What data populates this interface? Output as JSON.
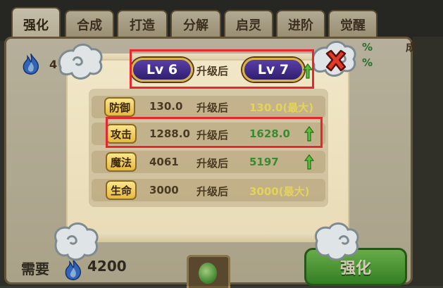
{
  "tabs": [
    {
      "label": "强化"
    },
    {
      "label": "合成"
    },
    {
      "label": "打造"
    },
    {
      "label": "分解"
    },
    {
      "label": "启灵"
    },
    {
      "label": "进阶"
    },
    {
      "label": "觉醒"
    }
  ],
  "background": {
    "cost_prefix_visible": "4",
    "pct_top": "%",
    "pct_bottom": "%",
    "top_right_text": "成"
  },
  "upgrade": {
    "current_level": "Lv 6",
    "after_label": "升级后",
    "next_level": "Lv 7"
  },
  "stats": [
    {
      "name": "防御",
      "old": "130.0",
      "after": "升级后",
      "new": "130.0(最大)",
      "new_color": "#e3d35a"
    },
    {
      "name": "攻击",
      "old": "1288.0",
      "after": "升级后",
      "new": "1628.0",
      "new_color": "#3b8a30"
    },
    {
      "name": "魔法",
      "old": "4061",
      "after": "升级后",
      "new": "5197",
      "new_color": "#3b8a30"
    },
    {
      "name": "生命",
      "old": "3000",
      "after": "升级后",
      "new": "3000(最大)",
      "new_color": "#e3d35a"
    }
  ],
  "footer": {
    "need_label": "需要",
    "cost": "4200",
    "strengthen_label": "强化"
  },
  "icons": {
    "flame": "blue-flame-icon",
    "close": "close-x-icon",
    "up": "green-up-arrow-icon"
  },
  "colors": {
    "highlight": "#e8262d",
    "level_pill": "#3f2a8a",
    "up_green": "#3b8a30",
    "max_yellow": "#e3d35a"
  }
}
